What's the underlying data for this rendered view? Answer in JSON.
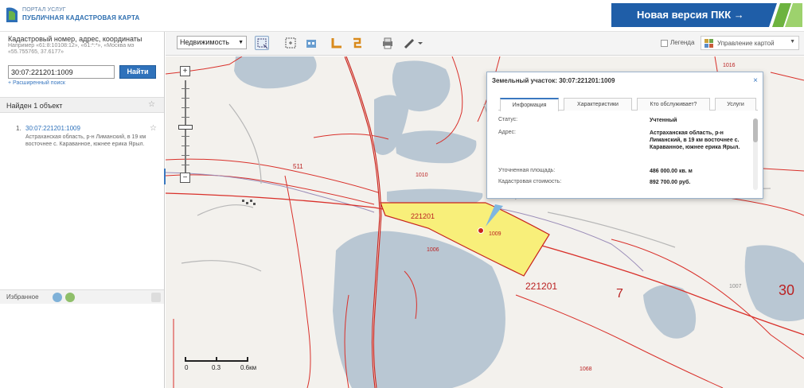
{
  "header": {
    "logo_line1": "ПОРТАЛ УСЛУГ",
    "logo_line2": "ПУБЛИЧНАЯ КАДАСТРОВАЯ КАРТА",
    "promo_label": "Новая версия ПКК →"
  },
  "sidebar": {
    "search_label": "Кадастровый номер, адрес, координаты",
    "search_hint": "Например «61:8:10108:12», «61:*:*»,  «Москва мэ «55.755765, 37.6177»",
    "search_value": "30:07:221201:1009",
    "find_label": "Найти",
    "advanced_link": "+ Расширенный поиск",
    "found_text": "Найден 1 объект",
    "result": {
      "number": "1.",
      "cad_number": "30:07:221201:1009",
      "description": "Астраханская область, р-н Лиманский, в 19 км восточнее с. Караванное, южнее ерика Ярыл."
    },
    "favorites_label": "Избранное"
  },
  "toolbar": {
    "layer_select": "Недвижимость",
    "legend_label": "Легенда",
    "map_mgmt_label": "Управление картой"
  },
  "popup": {
    "title": "Земельный участок: 30:07:221201:1009",
    "tabs": [
      "Информация",
      "Характеристики",
      "Кто обслуживает?",
      "Услуги"
    ],
    "rows": [
      {
        "key": "Статус:",
        "value": "Учтенный"
      },
      {
        "key": "Адрес:",
        "value": "Астраханская область, р-н Лиманский, в 19 км восточнее с. Караванное, южнее ерика Ярыл."
      },
      {
        "key": "Уточненная площадь:",
        "value": "486 000.00 кв. м"
      },
      {
        "key": "Кадастровая стоимость:",
        "value": "892 700.00 руб."
      }
    ]
  },
  "map": {
    "scale_labels": [
      "0",
      "0.3",
      "0.6км"
    ],
    "labels": [
      "1016",
      "511",
      "1010",
      "221201",
      "1009",
      "1006",
      "221201",
      "7",
      "30",
      "1007",
      "1068"
    ]
  },
  "colors": {
    "water": "#b9c7d3",
    "boundary": "#d9302a",
    "road": "#c8231c",
    "parcel": "#f8ef7a",
    "accent": "#2f72bb"
  }
}
